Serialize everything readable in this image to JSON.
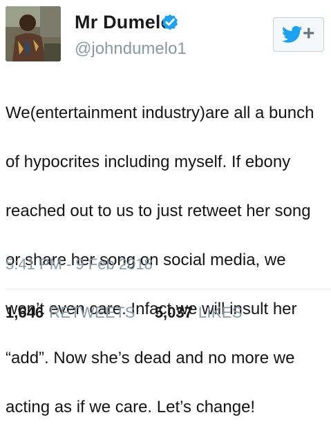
{
  "author": {
    "display_name": "Mr Dumelo",
    "handle": "@johndumelo1",
    "verified_icon": "verified-badge-icon",
    "verified_color": "#1da1f2"
  },
  "follow_button": {
    "icon": "twitter-bird-icon",
    "plus": "+",
    "bird_color": "#1da1f2"
  },
  "tweet": {
    "lines": [
      "We(entertainment industry)are all a bunch",
      "of hypocrites including myself. If ebony",
      "reached out to us to just retweet her song",
      "or share her song on social media, we",
      "won’t even care.  Infact we will insult her",
      "“add”.  Now she’s  dead and no more we",
      "acting as if we care. Let’s  change!"
    ],
    "timestamp": "5:41 PM - 9 Feb 2018"
  },
  "stats": {
    "retweets_count": "1,646",
    "retweets_label": "RETWEETS",
    "likes_count": "5,037",
    "likes_label": "LIKES"
  }
}
